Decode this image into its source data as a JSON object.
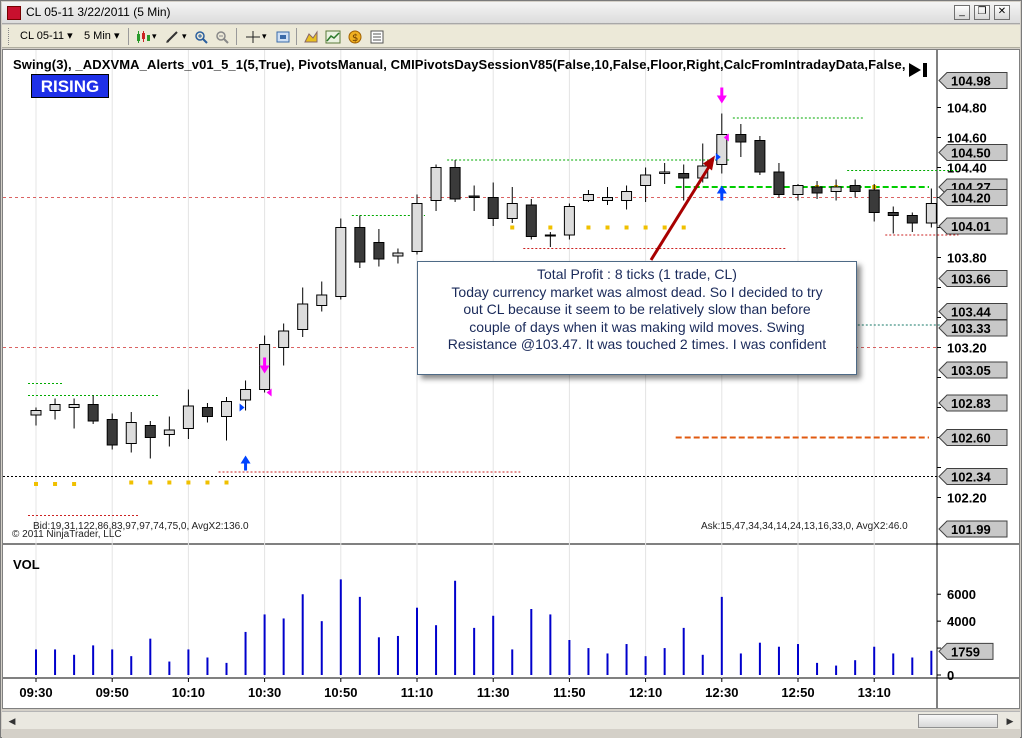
{
  "window": {
    "title": "CL 05-11  3/22/2011 (5 Min)",
    "minimize_glyph": "_",
    "restore_glyph": "❐",
    "close_glyph": "✕"
  },
  "toolbar": {
    "instrument": "CL 05-11",
    "interval": "5 Min",
    "icons": [
      "candlestick-icon",
      "draw-pencil-icon",
      "zoom-in-icon",
      "zoom-out-icon",
      "crosshair-icon",
      "snapshot-icon",
      "strategy-icon",
      "indicator-icon",
      "money-icon",
      "data-box-icon"
    ]
  },
  "indicators_text": "Swing(3),  _ADXVMA_Alerts_v01_5_1(5,True),  PivotsManual,  CMIPivotsDaySessionV85(False,10,False,Floor,Right,CalcFromIntradayData,False,",
  "rising_label": "RISING",
  "note_lines": [
    "Total Profit : 8 ticks (1 trade, CL)",
    "Today currency market was almost dead. So I decided to try",
    "out CL because it seem to be relatively slow than before",
    "couple of days when it was making wild moves. Swing",
    "Resistance @103.47. It was touched 2 times. I was confident"
  ],
  "copyright": "© 2011 NinjaTrader, LLC",
  "bid_text": "Bid:19,31,122,86,83,97,97,74,75,0, AvgX2:136.0",
  "ask_text": "Ask:15,47,34,34,14,24,13,16,33,0, AvgX2:46.0",
  "vol_label": "VOL",
  "colors": {
    "up_candle": "#dcdcdc",
    "down_candle": "#3a3a3a",
    "volume": "#0000cc",
    "green_line": "#00cc00",
    "orange_line": "#e05a10",
    "swing_dots": "#f0c000",
    "red_dotted": "#cc2222",
    "arrow_blue": "#0044ff",
    "arrow_magenta": "#ff00ff",
    "annotation_arrow": "#a80000"
  },
  "chart_data": {
    "type": "candlestick",
    "interval": "5 Min",
    "price_axis": {
      "ylim": [
        102.05,
        105.05
      ],
      "ticks": [
        102.2,
        102.4,
        102.6,
        102.8,
        103.0,
        103.2,
        103.4,
        103.6,
        103.8,
        104.0,
        104.2,
        104.4,
        104.6,
        104.8
      ],
      "tick_labels": [
        "102.20",
        "",
        "",
        "",
        "",
        "103.20",
        "",
        "",
        "103.80",
        "",
        "",
        "104.40",
        "104.60",
        "104.80"
      ]
    },
    "price_markers": [
      {
        "label": "104.98",
        "value": 104.98
      },
      {
        "label": "104.50",
        "value": 104.5
      },
      {
        "label": "104.27",
        "value": 104.27
      },
      {
        "label": "104.20",
        "value": 104.2
      },
      {
        "label": "104.01",
        "value": 104.01
      },
      {
        "label": "103.66",
        "value": 103.66
      },
      {
        "label": "103.44",
        "value": 103.44
      },
      {
        "label": "103.33",
        "value": 103.33
      },
      {
        "label": "103.05",
        "value": 103.05
      },
      {
        "label": "102.83",
        "value": 102.83
      },
      {
        "label": "102.60",
        "value": 102.6
      },
      {
        "label": "102.34",
        "value": 102.34
      },
      {
        "label": "101.99",
        "value": 101.99
      }
    ],
    "time_labels": [
      "09:30",
      "09:50",
      "10:10",
      "10:30",
      "10:50",
      "11:10",
      "11:30",
      "11:50",
      "12:10",
      "12:30",
      "12:50",
      "13:10"
    ],
    "candles": [
      {
        "o": 102.75,
        "h": 102.8,
        "l": 102.68,
        "c": 102.78
      },
      {
        "o": 102.78,
        "h": 102.86,
        "l": 102.72,
        "c": 102.82
      },
      {
        "o": 102.8,
        "h": 102.86,
        "l": 102.66,
        "c": 102.82
      },
      {
        "o": 102.82,
        "h": 102.88,
        "l": 102.69,
        "c": 102.71
      },
      {
        "o": 102.72,
        "h": 102.76,
        "l": 102.52,
        "c": 102.55
      },
      {
        "o": 102.56,
        "h": 102.77,
        "l": 102.5,
        "c": 102.7
      },
      {
        "o": 102.68,
        "h": 102.71,
        "l": 102.46,
        "c": 102.6
      },
      {
        "o": 102.62,
        "h": 102.74,
        "l": 102.54,
        "c": 102.65
      },
      {
        "o": 102.66,
        "h": 102.92,
        "l": 102.59,
        "c": 102.81
      },
      {
        "o": 102.8,
        "h": 102.83,
        "l": 102.7,
        "c": 102.74
      },
      {
        "o": 102.74,
        "h": 102.87,
        "l": 102.58,
        "c": 102.84
      },
      {
        "o": 102.85,
        "h": 102.98,
        "l": 102.78,
        "c": 102.92
      },
      {
        "o": 102.92,
        "h": 103.28,
        "l": 102.9,
        "c": 103.22
      },
      {
        "o": 103.2,
        "h": 103.36,
        "l": 103.08,
        "c": 103.31
      },
      {
        "o": 103.32,
        "h": 103.6,
        "l": 103.27,
        "c": 103.49
      },
      {
        "o": 103.48,
        "h": 103.64,
        "l": 103.44,
        "c": 103.55
      },
      {
        "o": 103.54,
        "h": 104.06,
        "l": 103.52,
        "c": 104.0
      },
      {
        "o": 104.0,
        "h": 104.08,
        "l": 103.73,
        "c": 103.77
      },
      {
        "o": 103.9,
        "h": 103.99,
        "l": 103.74,
        "c": 103.79
      },
      {
        "o": 103.81,
        "h": 103.86,
        "l": 103.76,
        "c": 103.83
      },
      {
        "o": 103.84,
        "h": 104.22,
        "l": 103.82,
        "c": 104.16
      },
      {
        "o": 104.18,
        "h": 104.42,
        "l": 104.11,
        "c": 104.4
      },
      {
        "o": 104.4,
        "h": 104.45,
        "l": 104.17,
        "c": 104.19
      },
      {
        "o": 104.21,
        "h": 104.28,
        "l": 104.11,
        "c": 104.2
      },
      {
        "o": 104.2,
        "h": 104.3,
        "l": 104.01,
        "c": 104.06
      },
      {
        "o": 104.06,
        "h": 104.27,
        "l": 104.03,
        "c": 104.16
      },
      {
        "o": 104.15,
        "h": 104.19,
        "l": 103.92,
        "c": 103.94
      },
      {
        "o": 103.95,
        "h": 103.97,
        "l": 103.87,
        "c": 103.95
      },
      {
        "o": 103.95,
        "h": 104.16,
        "l": 103.92,
        "c": 104.14
      },
      {
        "o": 104.18,
        "h": 104.25,
        "l": 104.17,
        "c": 104.22
      },
      {
        "o": 104.18,
        "h": 104.27,
        "l": 104.15,
        "c": 104.2
      },
      {
        "o": 104.18,
        "h": 104.28,
        "l": 104.12,
        "c": 104.24
      },
      {
        "o": 104.28,
        "h": 104.4,
        "l": 104.17,
        "c": 104.35
      },
      {
        "o": 104.36,
        "h": 104.43,
        "l": 104.29,
        "c": 104.37
      },
      {
        "o": 104.36,
        "h": 104.42,
        "l": 104.18,
        "c": 104.33
      },
      {
        "o": 104.33,
        "h": 104.56,
        "l": 104.3,
        "c": 104.41
      },
      {
        "o": 104.42,
        "h": 104.76,
        "l": 104.36,
        "c": 104.62
      },
      {
        "o": 104.62,
        "h": 104.69,
        "l": 104.47,
        "c": 104.57
      },
      {
        "o": 104.58,
        "h": 104.61,
        "l": 104.35,
        "c": 104.37
      },
      {
        "o": 104.37,
        "h": 104.43,
        "l": 104.2,
        "c": 104.22
      },
      {
        "o": 104.22,
        "h": 104.29,
        "l": 104.18,
        "c": 104.28
      },
      {
        "o": 104.27,
        "h": 104.31,
        "l": 104.19,
        "c": 104.23
      },
      {
        "o": 104.24,
        "h": 104.32,
        "l": 104.18,
        "c": 104.27
      },
      {
        "o": 104.28,
        "h": 104.32,
        "l": 104.2,
        "c": 104.24
      },
      {
        "o": 104.25,
        "h": 104.29,
        "l": 104.04,
        "c": 104.1
      },
      {
        "o": 104.1,
        "h": 104.14,
        "l": 103.96,
        "c": 104.08
      },
      {
        "o": 104.08,
        "h": 104.1,
        "l": 103.97,
        "c": 104.03
      },
      {
        "o": 104.03,
        "h": 104.26,
        "l": 104.0,
        "c": 104.16
      }
    ],
    "volume_axis": {
      "ylim": [
        0,
        7800
      ],
      "ticks": [
        0,
        2000,
        4000,
        6000
      ],
      "tick_labels": [
        "0",
        "2000",
        "4000",
        "6000"
      ]
    },
    "volume_marker": {
      "label": "1759",
      "value": 1759
    },
    "volume": [
      1900,
      1900,
      1500,
      2200,
      1900,
      1400,
      2700,
      1000,
      1900,
      1300,
      900,
      3200,
      4500,
      4200,
      6000,
      4000,
      7100,
      5800,
      2800,
      2900,
      5000,
      3700,
      7000,
      3500,
      4400,
      1900,
      4900,
      4500,
      2600,
      2000,
      1600,
      2300,
      1400,
      2000,
      3500,
      1500,
      5800,
      1600,
      2400,
      2100,
      2300,
      900,
      700,
      1100,
      2100,
      1600,
      1300,
      1800
    ],
    "lines": [
      {
        "kind": "resistance",
        "value": 104.27,
        "from": 34,
        "to": 48,
        "color": "#00cc00",
        "style": "dashed"
      },
      {
        "kind": "pivot",
        "value": 102.6,
        "from": 34,
        "to": 48,
        "color": "#e05a10",
        "style": "dashed"
      },
      {
        "kind": "session-low",
        "value": 102.34,
        "from": 0,
        "to": 48,
        "color": "#000000",
        "style": "dotted"
      }
    ]
  }
}
